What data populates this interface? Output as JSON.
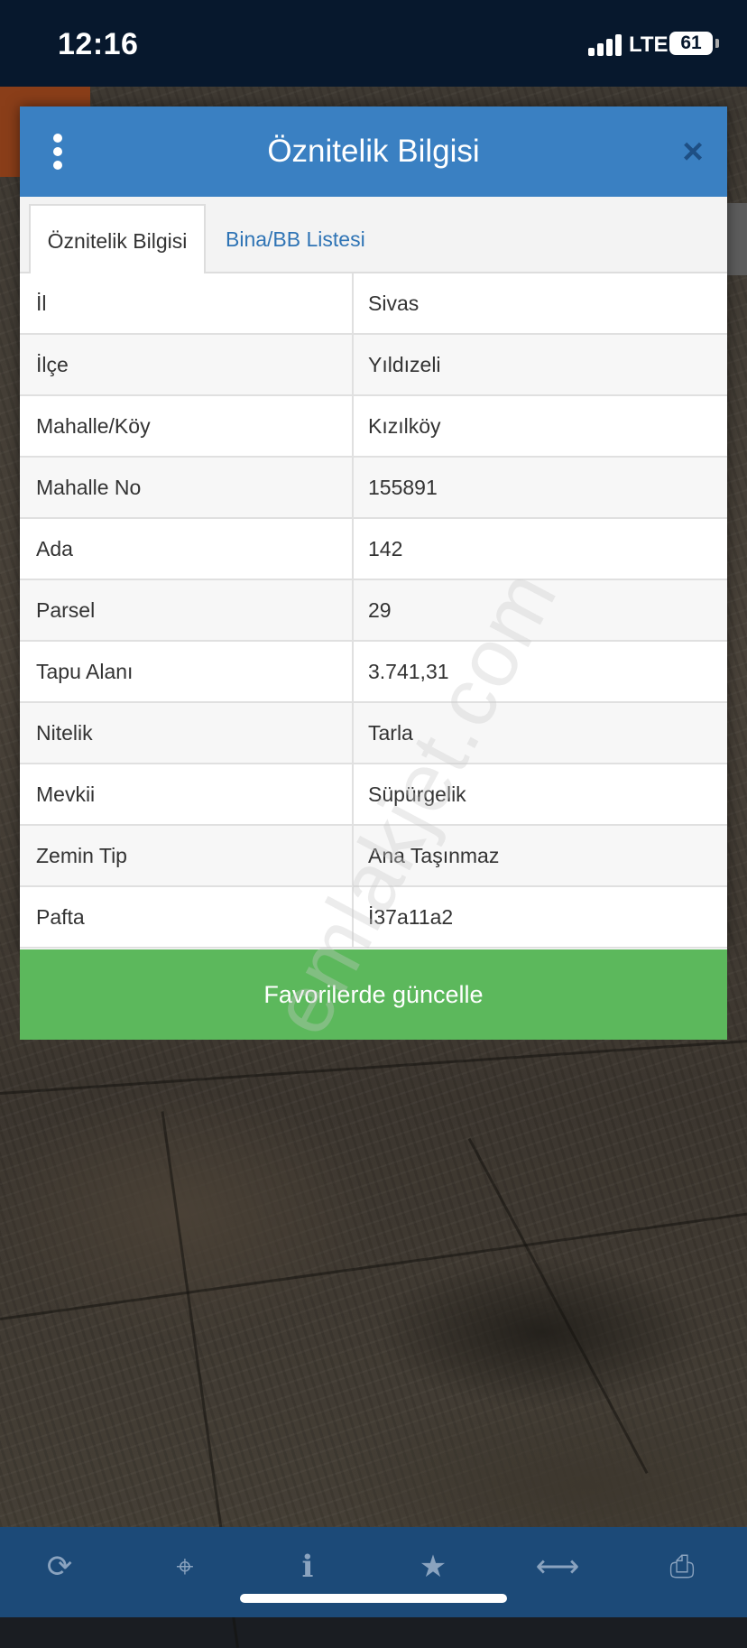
{
  "status_bar": {
    "time": "12:16",
    "network": "LTE",
    "battery": "61"
  },
  "modal": {
    "title": "Öznitelik Bilgisi",
    "close_icon": "×",
    "tabs": [
      {
        "label": "Öznitelik Bilgisi",
        "active": true
      },
      {
        "label": "Bina/BB Listesi",
        "active": false
      }
    ],
    "rows": [
      {
        "key": "İl",
        "value": "Sivas"
      },
      {
        "key": "İlçe",
        "value": "Yıldızeli"
      },
      {
        "key": "Mahalle/Köy",
        "value": "Kızılköy"
      },
      {
        "key": "Mahalle No",
        "value": "155891"
      },
      {
        "key": "Ada",
        "value": "142"
      },
      {
        "key": "Parsel",
        "value": "29"
      },
      {
        "key": "Tapu Alanı",
        "value": "3.741,31"
      },
      {
        "key": "Nitelik",
        "value": "Tarla"
      },
      {
        "key": "Mevkii",
        "value": "Süpürgelik"
      },
      {
        "key": "Zemin Tip",
        "value": "Ana Taşınmaz"
      },
      {
        "key": "Pafta",
        "value": "İ37a11a2"
      }
    ],
    "action_button": "Favorilerde güncelle"
  },
  "watermark": "emlakjet.com",
  "toolbar": {
    "icons": [
      "refresh-icon",
      "crosshair-icon",
      "info-icon",
      "star-icon",
      "measure-icon",
      "print-icon"
    ],
    "glyphs": [
      "⟳",
      "⌖",
      "i",
      "★",
      "⟷",
      "⎙"
    ]
  },
  "colors": {
    "header_blue": "#3a80c2",
    "button_green": "#5cb85c",
    "toolbar_blue": "#1c4a78",
    "status_bar": "#07182d"
  }
}
